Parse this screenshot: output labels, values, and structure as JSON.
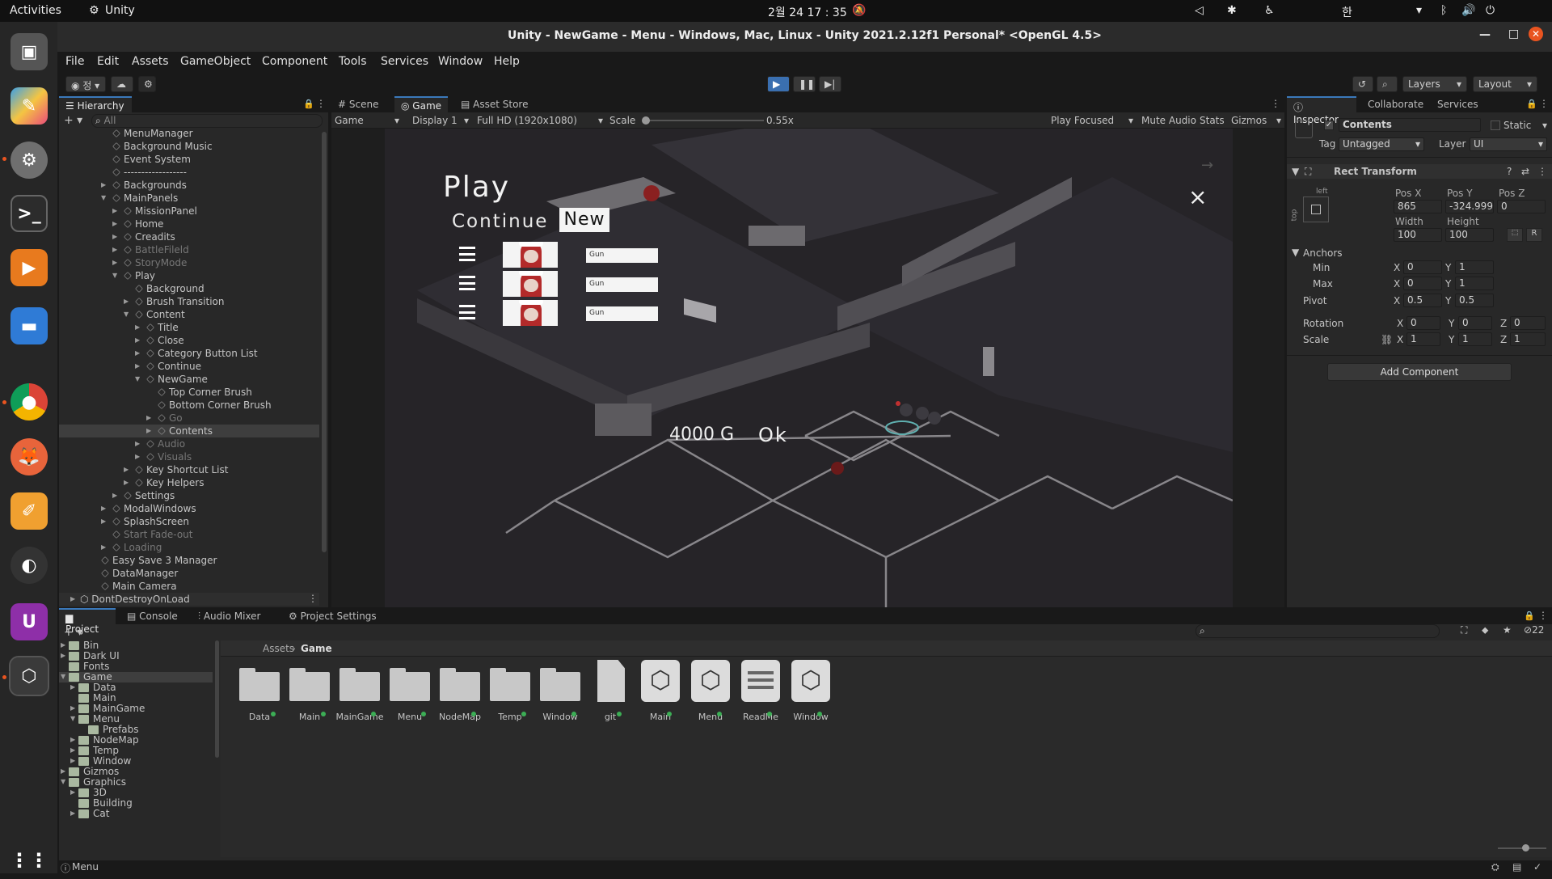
{
  "os": {
    "activities": "Activities",
    "app": "Unity",
    "clock": "2월 24  17 : 35",
    "ime": "한"
  },
  "window": {
    "title": "Unity - NewGame - Menu - Windows, Mac, Linux - Unity 2021.2.12f1 Personal* <OpenGL 4.5>"
  },
  "menu": [
    "File",
    "Edit",
    "Assets",
    "GameObject",
    "Component",
    "Tools",
    "Services",
    "Window",
    "Help"
  ],
  "toolbar": {
    "account": "정",
    "layers": "Layers",
    "layout": "Layout"
  },
  "hierarchy": {
    "tab": "Hierarchy",
    "search_placeholder": "All",
    "items": [
      {
        "label": "MenuManager",
        "depth": 1,
        "dim": false,
        "arrow": ""
      },
      {
        "label": "Background Music",
        "depth": 1,
        "dim": false,
        "arrow": ""
      },
      {
        "label": "Event System",
        "depth": 1,
        "dim": false,
        "arrow": ""
      },
      {
        "label": "------------------",
        "depth": 1,
        "dim": false,
        "arrow": ""
      },
      {
        "label": "Backgrounds",
        "depth": 1,
        "dim": false,
        "arrow": "▶"
      },
      {
        "label": "MainPanels",
        "depth": 1,
        "dim": false,
        "arrow": "▼"
      },
      {
        "label": "MissionPanel",
        "depth": 2,
        "dim": false,
        "arrow": "▶"
      },
      {
        "label": "Home",
        "depth": 2,
        "dim": false,
        "arrow": "▶"
      },
      {
        "label": "Creadits",
        "depth": 2,
        "dim": false,
        "arrow": "▶"
      },
      {
        "label": "BattleFileld",
        "depth": 2,
        "dim": true,
        "arrow": "▶"
      },
      {
        "label": "StoryMode",
        "depth": 2,
        "dim": true,
        "arrow": "▶"
      },
      {
        "label": "Play",
        "depth": 2,
        "dim": false,
        "arrow": "▼"
      },
      {
        "label": "Background",
        "depth": 3,
        "dim": false,
        "arrow": ""
      },
      {
        "label": "Brush Transition",
        "depth": 3,
        "dim": false,
        "arrow": "▶"
      },
      {
        "label": "Content",
        "depth": 3,
        "dim": false,
        "arrow": "▼"
      },
      {
        "label": "Title",
        "depth": 4,
        "dim": false,
        "arrow": "▶"
      },
      {
        "label": "Close",
        "depth": 4,
        "dim": false,
        "arrow": "▶"
      },
      {
        "label": "Category Button List",
        "depth": 4,
        "dim": false,
        "arrow": "▶"
      },
      {
        "label": "Continue",
        "depth": 4,
        "dim": false,
        "arrow": "▶"
      },
      {
        "label": "NewGame",
        "depth": 4,
        "dim": false,
        "arrow": "▼"
      },
      {
        "label": "Top Corner Brush",
        "depth": 5,
        "dim": false,
        "arrow": ""
      },
      {
        "label": "Bottom Corner Brush",
        "depth": 5,
        "dim": false,
        "arrow": ""
      },
      {
        "label": "Go",
        "depth": 5,
        "dim": true,
        "arrow": "▶"
      },
      {
        "label": "Contents",
        "depth": 5,
        "dim": false,
        "arrow": "▶",
        "selected": true
      },
      {
        "label": "Audio",
        "depth": 4,
        "dim": true,
        "arrow": "▶"
      },
      {
        "label": "Visuals",
        "depth": 4,
        "dim": true,
        "arrow": "▶"
      },
      {
        "label": "Key Shortcut List",
        "depth": 3,
        "dim": false,
        "arrow": "▶"
      },
      {
        "label": "Key Helpers",
        "depth": 3,
        "dim": false,
        "arrow": "▶"
      },
      {
        "label": "Settings",
        "depth": 2,
        "dim": false,
        "arrow": "▶"
      },
      {
        "label": "ModalWindows",
        "depth": 1,
        "dim": false,
        "arrow": "▶"
      },
      {
        "label": "SplashScreen",
        "depth": 1,
        "dim": false,
        "arrow": "▶"
      },
      {
        "label": "Start Fade-out",
        "depth": 1,
        "dim": true,
        "arrow": ""
      },
      {
        "label": "Loading",
        "depth": 1,
        "dim": true,
        "arrow": "▶"
      },
      {
        "label": "Easy Save 3 Manager",
        "depth": 0,
        "dim": false,
        "arrow": ""
      },
      {
        "label": "DataManager",
        "depth": 0,
        "dim": false,
        "arrow": ""
      },
      {
        "label": "Main Camera",
        "depth": 0,
        "dim": false,
        "arrow": ""
      }
    ],
    "ddol": "DontDestroyOnLoad"
  },
  "scene_tabs": [
    "Scene",
    "Game",
    "Asset Store"
  ],
  "game_bar": {
    "display_mode": "Game",
    "display": "Display 1",
    "resolution": "Full HD (1920x1080)",
    "scale_label": "Scale",
    "scale_value": "0.55x",
    "play_focused": "Play Focused",
    "mute": "Mute Audio",
    "stats": "Stats",
    "gizmos": "Gizmos"
  },
  "game": {
    "title": "Play",
    "tab_continue": "Continue",
    "tab_new": "New",
    "slots": [
      "Gun",
      "Gun",
      "Gun"
    ],
    "gold": "4000 G",
    "ok": "Ok",
    "close": "×"
  },
  "inspector": {
    "tabs": [
      "Inspector",
      "Collaborate",
      "Services"
    ],
    "object_name": "Contents",
    "static": "Static",
    "tag_label": "Tag",
    "tag": "Untagged",
    "layer_label": "Layer",
    "layer": "UI",
    "component": "Rect Transform",
    "anchor_h": "left",
    "anchor_v": "top",
    "posx_label": "Pos X",
    "posy_label": "Pos Y",
    "posz_label": "Pos Z",
    "posx": "865",
    "posy": "-324.9999",
    "posz": "0",
    "width_label": "Width",
    "height_label": "Height",
    "width": "100",
    "height": "100",
    "anchors": "Anchors",
    "min": "Min",
    "max": "Max",
    "min_x": "0",
    "min_y": "1",
    "max_x": "0",
    "max_y": "1",
    "pivot": "Pivot",
    "pivot_x": "0.5",
    "pivot_y": "0.5",
    "rotation": "Rotation",
    "rot_x": "0",
    "rot_y": "0",
    "rot_z": "0",
    "scale": "Scale",
    "sc_x": "1",
    "sc_y": "1",
    "sc_z": "1",
    "x": "X",
    "y": "Y",
    "z": "Z",
    "r": "R",
    "add_component": "Add Component"
  },
  "bottom_tabs": [
    "Project",
    "Console",
    "Audio Mixer",
    "Project Settings"
  ],
  "project": {
    "tree": [
      {
        "label": "Bin",
        "depth": 1,
        "arrow": "▶"
      },
      {
        "label": "Dark UI",
        "depth": 1,
        "arrow": "▶"
      },
      {
        "label": "Fonts",
        "depth": 1,
        "arrow": ""
      },
      {
        "label": "Game",
        "depth": 1,
        "arrow": "▼",
        "selected": true
      },
      {
        "label": "Data",
        "depth": 2,
        "arrow": "▶"
      },
      {
        "label": "Main",
        "depth": 2,
        "arrow": ""
      },
      {
        "label": "MainGame",
        "depth": 2,
        "arrow": "▶"
      },
      {
        "label": "Menu",
        "depth": 2,
        "arrow": "▼"
      },
      {
        "label": "Prefabs",
        "depth": 3,
        "arrow": ""
      },
      {
        "label": "NodeMap",
        "depth": 2,
        "arrow": "▶"
      },
      {
        "label": "Temp",
        "depth": 2,
        "arrow": "▶"
      },
      {
        "label": "Window",
        "depth": 2,
        "arrow": "▶"
      },
      {
        "label": "Gizmos",
        "depth": 1,
        "arrow": "▶"
      },
      {
        "label": "Graphics",
        "depth": 1,
        "arrow": "▼"
      },
      {
        "label": "3D",
        "depth": 2,
        "arrow": "▶"
      },
      {
        "label": "Building",
        "depth": 2,
        "arrow": ""
      },
      {
        "label": "Cat",
        "depth": 2,
        "arrow": "▶"
      }
    ],
    "breadcrumb": [
      "Assets",
      "Game"
    ],
    "assets": [
      {
        "label": "Data",
        "kind": "folder"
      },
      {
        "label": "Main",
        "kind": "folder"
      },
      {
        "label": "MainGame",
        "kind": "folder"
      },
      {
        "label": "Menu",
        "kind": "folder"
      },
      {
        "label": "NodeMap",
        "kind": "folder"
      },
      {
        "label": "Temp",
        "kind": "folder"
      },
      {
        "label": "Window",
        "kind": "folder"
      },
      {
        "label": "git",
        "kind": "file"
      },
      {
        "label": "Main",
        "kind": "unity"
      },
      {
        "label": "Menu",
        "kind": "unity"
      },
      {
        "label": "ReadMe",
        "kind": "doc"
      },
      {
        "label": "Window",
        "kind": "unity"
      }
    ],
    "hidden_count": "22"
  },
  "status": {
    "text": "Menu"
  }
}
